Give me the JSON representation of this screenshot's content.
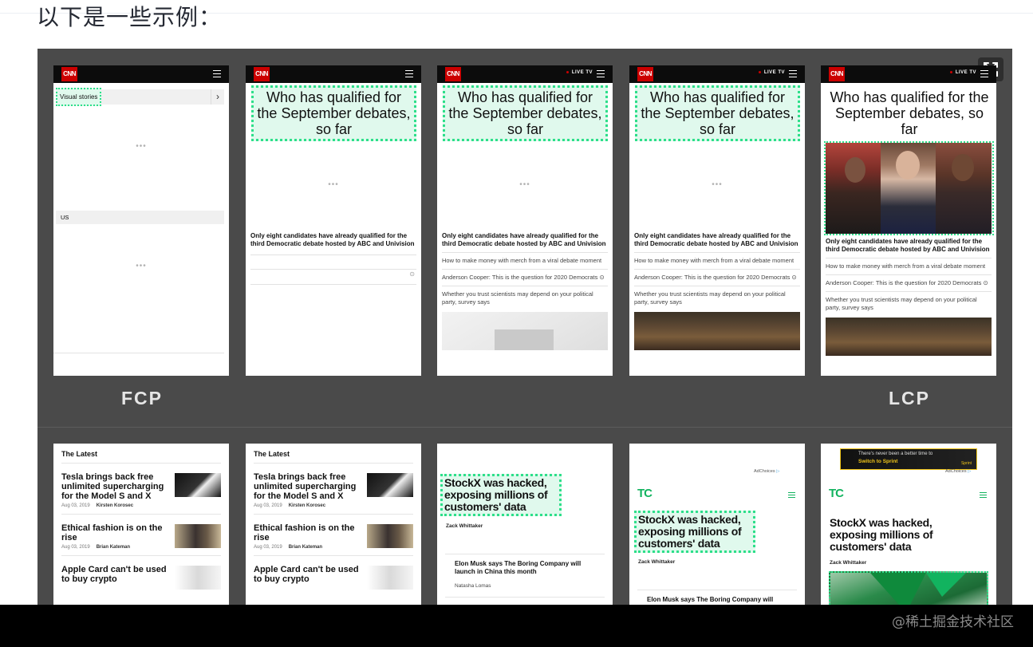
{
  "intro": "以下是一些示例：",
  "labels": {
    "fcp": "FCP",
    "lcp": "LCP"
  },
  "watermark": "@稀土掘金技术社区",
  "cnn": {
    "logo": "CNN",
    "live_tv": "LIVE TV",
    "visual_stories": "Visual stories",
    "us": "US",
    "headline": "Who has qualified for the September debates, so far",
    "lead": "Only eight candidates have already qualified for the third Democratic debate hosted by ABC and Univision",
    "stories": [
      "How to make money with merch from a viral debate moment",
      "Anderson Cooper: This is the question for 2020 Democrats",
      "Whether you trust scientists may depend on your political party, survey says"
    ]
  },
  "latest": {
    "title": "The Latest",
    "items": [
      {
        "title": "Tesla brings back free unlimited supercharging for the Model S and X",
        "date": "Aug 03, 2019",
        "author": "Kirsten Korosec"
      },
      {
        "title": "Ethical fashion is on the rise",
        "date": "Aug 03, 2019",
        "author": "Brian Kateman"
      },
      {
        "title": "Apple Card can't be used to buy crypto",
        "date": "",
        "author": ""
      }
    ]
  },
  "tc": {
    "logo": "TC",
    "headline": "StockX was hacked, exposing millions of customers' data",
    "author": "Zack Whittaker",
    "next_story": "Elon Musk says The Boring Company will launch in China this month",
    "next_author": "Natasha Lomas",
    "adchoices": "AdChoices",
    "ad_line1": "There's never been a better time to",
    "ad_line2": "Switch to Sprint",
    "ad_brand": "Sprint"
  }
}
